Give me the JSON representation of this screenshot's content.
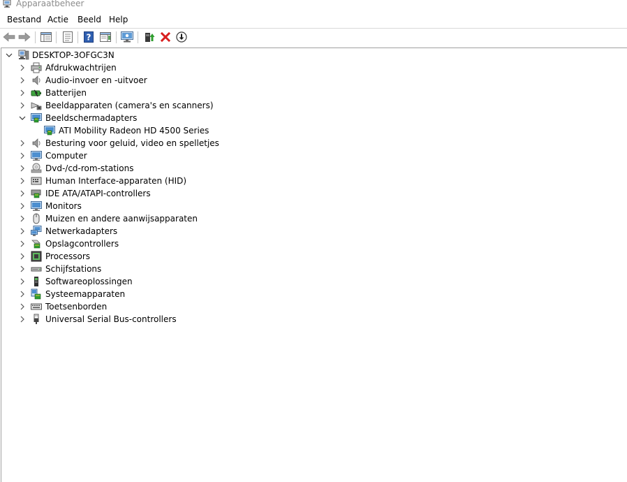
{
  "window": {
    "title": "Apparaatbeheer"
  },
  "menu": [
    {
      "label": "Bestand"
    },
    {
      "label": "Actie"
    },
    {
      "label": "Beeld"
    },
    {
      "label": "Help"
    }
  ],
  "toolbar": {
    "buttons": [
      {
        "name": "back-button",
        "icon": "arrow-left-icon"
      },
      {
        "name": "forward-button",
        "icon": "arrow-right-icon"
      },
      {
        "name": "show-hide-console-tree-button",
        "icon": "console-tree-icon"
      },
      {
        "name": "properties-button",
        "icon": "properties-icon"
      },
      {
        "name": "help-button",
        "icon": "help-icon"
      },
      {
        "name": "action-pane-button",
        "icon": "action-pane-icon"
      },
      {
        "name": "scan-hardware-button",
        "icon": "monitor-scan-icon"
      },
      {
        "name": "update-driver-button",
        "icon": "update-driver-icon"
      },
      {
        "name": "uninstall-device-button",
        "icon": "red-x-icon"
      },
      {
        "name": "disable-device-button",
        "icon": "down-arrow-circle-icon"
      }
    ]
  },
  "tree": {
    "root": {
      "label": "DESKTOP-3OFGC3N",
      "expanded": true,
      "icon": "computer-root-icon"
    },
    "items": [
      {
        "label": "Afdrukwachtrijen",
        "icon": "printer-icon",
        "expanded": false
      },
      {
        "label": "Audio-invoer en -uitvoer",
        "icon": "speaker-icon",
        "expanded": false
      },
      {
        "label": "Batterijen",
        "icon": "battery-icon",
        "expanded": false
      },
      {
        "label": "Beeldapparaten (camera's en scanners)",
        "icon": "camera-icon",
        "expanded": false
      },
      {
        "label": "Beeldschermadapters",
        "icon": "display-adapter-icon",
        "expanded": true,
        "children": [
          {
            "label": "ATI Mobility Radeon HD 4500 Series",
            "icon": "display-adapter-icon"
          }
        ]
      },
      {
        "label": "Besturing voor geluid, video en spelletjes",
        "icon": "speaker-icon",
        "expanded": false
      },
      {
        "label": "Computer",
        "icon": "monitor-icon",
        "expanded": false
      },
      {
        "label": "Dvd-/cd-rom-stations",
        "icon": "disc-drive-icon",
        "expanded": false
      },
      {
        "label": "Human Interface-apparaten (HID)",
        "icon": "hid-icon",
        "expanded": false
      },
      {
        "label": "IDE ATA/ATAPI-controllers",
        "icon": "ide-controller-icon",
        "expanded": false
      },
      {
        "label": "Monitors",
        "icon": "monitor-icon",
        "expanded": false
      },
      {
        "label": "Muizen en andere aanwijsapparaten",
        "icon": "mouse-icon",
        "expanded": false
      },
      {
        "label": "Netwerkadapters",
        "icon": "network-adapter-icon",
        "expanded": false
      },
      {
        "label": "Opslagcontrollers",
        "icon": "storage-controller-icon",
        "expanded": false
      },
      {
        "label": "Processors",
        "icon": "processor-icon",
        "expanded": false
      },
      {
        "label": "Schijfstations",
        "icon": "disk-drive-icon",
        "expanded": false
      },
      {
        "label": "Softwareoplossingen",
        "icon": "software-component-icon",
        "expanded": false
      },
      {
        "label": "Systeemapparaten",
        "icon": "system-device-icon",
        "expanded": false
      },
      {
        "label": "Toetsenborden",
        "icon": "keyboard-icon",
        "expanded": false
      },
      {
        "label": "Universal Serial Bus-controllers",
        "icon": "usb-icon",
        "expanded": false
      }
    ]
  },
  "colors": {
    "accent": "#3c78c8",
    "red": "#d81e1e",
    "green": "#2e9d2e"
  }
}
